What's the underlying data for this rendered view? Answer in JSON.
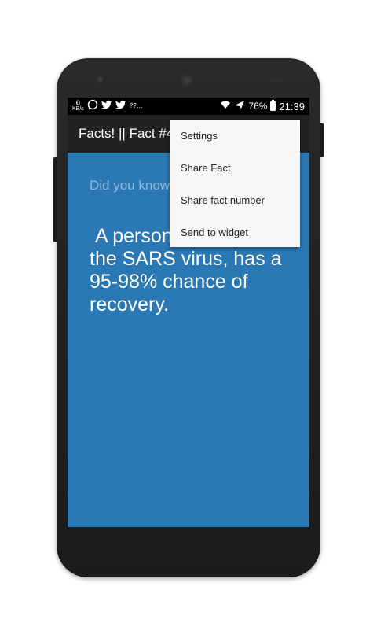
{
  "status_bar": {
    "kbs_value": "0",
    "kbs_unit": "KB/s",
    "network_speed_text": "??…",
    "battery_percent": "76%",
    "time": "21:39",
    "icons": [
      "whatsapp-icon",
      "twitter-icon",
      "twitter-icon",
      "wifi-icon",
      "airplane-icon",
      "battery-icon"
    ]
  },
  "action_bar": {
    "title": "Facts! || Fact #4"
  },
  "content": {
    "heading": "Did you know",
    "fact": " A person infected with the SARS virus, has a 95-98% chance of recovery."
  },
  "overflow_menu": {
    "items": [
      {
        "label": "Settings"
      },
      {
        "label": "Share Fact"
      },
      {
        "label": "Share fact number"
      },
      {
        "label": "Send to widget"
      }
    ]
  },
  "colors": {
    "content_background": "#2a78b4",
    "action_bar": "#222222",
    "menu_background": "#f7f7f7"
  }
}
